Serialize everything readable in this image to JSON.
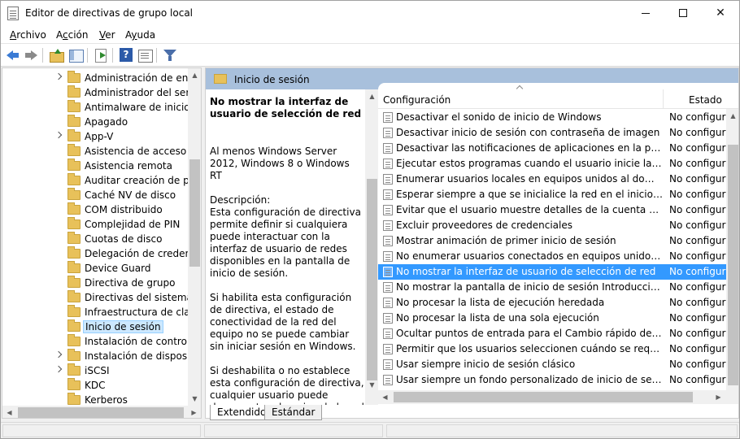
{
  "window": {
    "title": "Editor de directivas de grupo local",
    "controls": {
      "minimize": "",
      "maximize": "",
      "close": "✕"
    }
  },
  "menu": {
    "items": [
      {
        "label": "Archivo",
        "accel": "A",
        "rest": "rchivo"
      },
      {
        "label": "Acción",
        "accel": "c",
        "pre": "A",
        "rest": "ción"
      },
      {
        "label": "Ver",
        "accel": "V",
        "rest": "er"
      },
      {
        "label": "Ayuda",
        "accel": "y",
        "pre": "A",
        "rest": "uda"
      }
    ]
  },
  "tree": {
    "items": [
      "Administración de energía",
      "Administrador del servicio",
      "Antimalware de inicio temprano",
      "Apagado",
      "App-V",
      "Asistencia de acceso denegado",
      "Asistencia remota",
      "Auditar creación de procesos",
      "Caché NV de disco",
      "COM distribuido",
      "Complejidad de PIN",
      "Cuotas de disco",
      "Delegación de credenciales",
      "Device Guard",
      "Directiva de grupo",
      "Directivas del sistema operativo",
      "Infraestructura de clasificación",
      "Inicio de sesión",
      "Instalación de controladores",
      "Instalación de dispositivos",
      "iSCSI",
      "KDC",
      "Kerberos"
    ],
    "expandable": [
      true,
      false,
      false,
      false,
      true,
      false,
      false,
      false,
      false,
      false,
      false,
      false,
      false,
      false,
      false,
      false,
      false,
      false,
      false,
      true,
      true,
      false,
      false
    ],
    "selected_index": 17
  },
  "header": {
    "title": "Inicio de sesión"
  },
  "description": {
    "title": "No mostrar la interfaz de usuario de selección de red",
    "body": "Al menos Windows Server 2012, Windows 8 o Windows RT\n\nDescripción:\nEsta configuración de directiva permite definir si cualquiera puede interactuar con la interfaz de usuario de redes disponibles en la pantalla de inicio de sesión.\n\nSi habilita esta configuración de directiva, el estado de conectividad de la red del equipo no se puede cambiar sin iniciar sesión en Windows.\n\nSi deshabilita o no establece esta configuración de directiva, cualquier usuario puede desconectar el equipo de la red o conectarlo a otras redes disponibles sin iniciar sesión en Windows."
  },
  "settings": {
    "col_setting": "Configuración",
    "col_state": "Estado",
    "rows": [
      {
        "name": "Desactivar el sonido de inicio de Windows",
        "state": "No configurada"
      },
      {
        "name": "Desactivar inicio de sesión con contraseña de imagen",
        "state": "No configurada"
      },
      {
        "name": "Desactivar las notificaciones de aplicaciones en la pantalla de bloqueo",
        "state": "No configurada"
      },
      {
        "name": "Ejecutar estos programas cuando el usuario inicie la sesión",
        "state": "No configurada"
      },
      {
        "name": "Enumerar usuarios locales en equipos unidos al dominio",
        "state": "No configurada"
      },
      {
        "name": "Esperar siempre a que se inicialice la red en el inicio del equipo y en el inicio de sesión",
        "state": "No configurada"
      },
      {
        "name": "Evitar que el usuario muestre detalles de la cuenta al iniciar sesión",
        "state": "No configurada"
      },
      {
        "name": "Excluir proveedores de credenciales",
        "state": "No configurada"
      },
      {
        "name": "Mostrar animación de primer inicio de sesión",
        "state": "No configurada"
      },
      {
        "name": "No enumerar usuarios conectados en equipos unidos al dominio",
        "state": "No configurada"
      },
      {
        "name": "No mostrar la interfaz de usuario de selección de red",
        "state": "No configurada"
      },
      {
        "name": "No mostrar la pantalla de inicio de sesión Introducción al iniciar sesión",
        "state": "No configurada"
      },
      {
        "name": "No procesar la lista de ejecución heredada",
        "state": "No configurada"
      },
      {
        "name": "No procesar la lista de una sola ejecución",
        "state": "No configurada"
      },
      {
        "name": "Ocultar puntos de entrada para el Cambio rápido de usuario",
        "state": "No configurada"
      },
      {
        "name": "Permitir que los usuarios seleccionen cuándo se requiere una contraseña",
        "state": "No configurada"
      },
      {
        "name": "Usar siempre inicio de sesión clásico",
        "state": "No configurada"
      },
      {
        "name": "Usar siempre un fondo personalizado de inicio de sesión",
        "state": "No configurada"
      }
    ],
    "selected_index": 10
  },
  "tabs": {
    "extended": "Extendido",
    "standard": "Estándar"
  },
  "icons": {
    "back": "arrow-left-icon",
    "forward": "arrow-right-icon",
    "up": "folder-up-icon",
    "showhide": "show-hide-tree-icon",
    "export": "export-list-icon",
    "help": "help-icon",
    "properties": "properties-icon",
    "filter": "filter-icon"
  },
  "colors": {
    "selection": "#3399ff",
    "header_band": "#a8c0dc",
    "folder": "#e8c15a"
  }
}
